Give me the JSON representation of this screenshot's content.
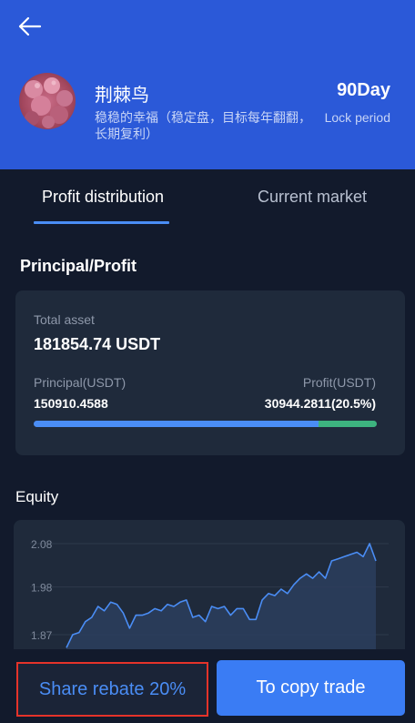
{
  "header": {
    "back_icon": "arrow-left-icon",
    "name": "荆棘鸟",
    "description": "稳稳的幸福（稳定盘，目标每年翻翻，长期复利）",
    "lock_days": "90Day",
    "lock_label": "Lock period"
  },
  "tabs": [
    {
      "label": "Profit distribution",
      "active": true
    },
    {
      "label": "Current market",
      "active": false
    }
  ],
  "principal_profit": {
    "title": "Principal/Profit",
    "total_asset_label": "Total asset",
    "total_asset_value": "181854.74 USDT",
    "principal_label": "Principal(USDT)",
    "principal_value": "150910.4588",
    "profit_label": "Profit(USDT)",
    "profit_value": "30944.2811(20.5%)",
    "principal_share": 0.83,
    "colors": {
      "principal": "#4a8df5",
      "profit": "#3db37f"
    }
  },
  "equity": {
    "title": "Equity"
  },
  "chart_data": {
    "type": "area",
    "title": "",
    "xlabel": "",
    "ylabel": "",
    "y_ticks": [
      "2.08",
      "1.98",
      "1.87"
    ],
    "ylim": [
      1.78,
      2.13
    ],
    "grid": true,
    "series": [
      {
        "values": [
          1.84,
          1.87,
          1.875,
          1.9,
          1.91,
          1.935,
          1.925,
          1.945,
          1.94,
          1.92,
          1.885,
          1.915,
          1.915,
          1.92,
          1.93,
          1.925,
          1.94,
          1.935,
          1.945,
          1.95,
          1.91,
          1.915,
          1.9,
          1.935,
          1.93,
          1.935,
          1.915,
          1.93,
          1.93,
          1.905,
          1.905,
          1.95,
          1.965,
          1.96,
          1.975,
          1.965,
          1.985,
          2.0,
          2.01,
          2.0,
          2.015,
          2.0,
          2.04,
          2.045,
          2.05,
          2.055,
          2.06,
          2.05,
          2.08,
          2.04
        ],
        "color": "#4a8df5"
      }
    ]
  },
  "footer": {
    "rebate_label": "Share rebate 20%",
    "copy_label": "To copy trade"
  }
}
